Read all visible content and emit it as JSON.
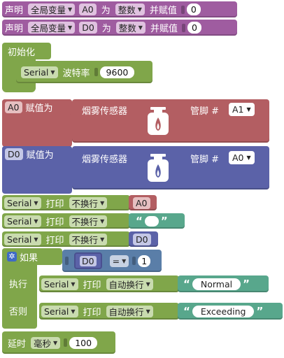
{
  "global_a0": {
    "declare": "声明",
    "scope": "全局变量",
    "var": "A0",
    "as": "为",
    "type": "整数",
    "assign": "并赋值",
    "value": "0"
  },
  "global_d0": {
    "declare": "声明",
    "scope": "全局变量",
    "var": "D0",
    "as": "为",
    "type": "整数",
    "assign": "并赋值",
    "value": "0"
  },
  "setup": {
    "title": "初始化",
    "serial": "Serial",
    "baud_label": "波特率",
    "baud": "9600"
  },
  "assign_a0": {
    "var": "A0",
    "label": "赋值为",
    "sensor": "烟雾传感器",
    "pin_label": "管脚 #",
    "pin": "A1"
  },
  "assign_d0": {
    "var": "D0",
    "label": "赋值为",
    "sensor": "烟雾传感器",
    "pin_label": "管脚 #",
    "pin": "A0"
  },
  "print1": {
    "serial": "Serial",
    "action": "打印",
    "mode": "不换行",
    "value": "A0"
  },
  "print2": {
    "serial": "Serial",
    "action": "打印",
    "mode": "不换行",
    "value": ""
  },
  "print3": {
    "serial": "Serial",
    "action": "打印",
    "mode": "不换行",
    "value": "D0"
  },
  "if_block": {
    "if_label": "如果",
    "var": "D0",
    "op": "=",
    "value": "1",
    "then_label": "执行",
    "then_serial": "Serial",
    "then_action": "打印",
    "then_mode": "自动换行",
    "then_text": "Normal",
    "else_label": "否则",
    "else_serial": "Serial",
    "else_action": "打印",
    "else_mode": "自动换行",
    "else_text": "Exceeding"
  },
  "delay": {
    "label": "延时",
    "unit": "毫秒",
    "value": "100"
  },
  "colors": {
    "var_block": "#9f5ca0",
    "setup": "#80a64a",
    "sensor_a": "#b35e62",
    "sensor_b": "#5b62a8",
    "serial": "#80a64a",
    "text": "#58a78c",
    "logic": "#5a7ea8"
  }
}
